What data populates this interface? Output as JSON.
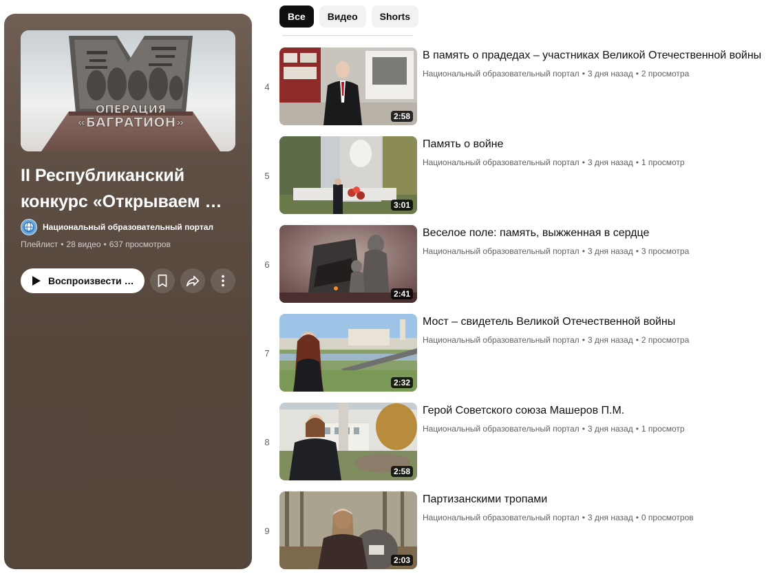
{
  "filters": {
    "chips": [
      {
        "label": "Все",
        "active": true
      },
      {
        "label": "Видео",
        "active": false
      },
      {
        "label": "Shorts",
        "active": false
      }
    ]
  },
  "playlist": {
    "title": "II Республиканский конкурс «Открываем …",
    "channel": "Национальный образовательный портал",
    "type": "Плейлист",
    "video_count": "28 видео",
    "views": "637 просмотров",
    "thumbnail_text_line1": "ОПЕРАЦИЯ",
    "thumbnail_text_line2": "«БАГРАТИОН»",
    "play_label": "Воспроизвести все"
  },
  "videos": [
    {
      "index": "4",
      "title": "В память о прадедах – участниках Великой Отечественной войны",
      "channel": "Национальный образовательный портал",
      "age": "3 дня назад",
      "views": "2 просмотра",
      "duration": "2:58"
    },
    {
      "index": "5",
      "title": "Память о войне",
      "channel": "Национальный образовательный портал",
      "age": "3 дня назад",
      "views": "1 просмотр",
      "duration": "3:01"
    },
    {
      "index": "6",
      "title": "Веселое поле: память, выжженная в сердце",
      "channel": "Национальный образовательный портал",
      "age": "3 дня назад",
      "views": "3 просмотра",
      "duration": "2:41"
    },
    {
      "index": "7",
      "title": "Мост – свидетель Великой Отечественной войны",
      "channel": "Национальный образовательный портал",
      "age": "3 дня назад",
      "views": "2 просмотра",
      "duration": "2:32"
    },
    {
      "index": "8",
      "title": "Герой Советского союза Машеров П.М.",
      "channel": "Национальный образовательный портал",
      "age": "3 дня назад",
      "views": "1 просмотр",
      "duration": "2:58"
    },
    {
      "index": "9",
      "title": "Партизанскими тропами",
      "channel": "Национальный образовательный портал",
      "age": "3 дня назад",
      "views": "0 просмотров",
      "duration": "2:03"
    }
  ],
  "icons": {
    "play": "play-icon",
    "save": "bookmark-icon",
    "share": "share-icon",
    "more": "more-vertical-icon"
  },
  "colors": {
    "panel_bg": "#55463c",
    "chip_active": "#0f0f0f",
    "chip_inactive": "#f2f2f2"
  }
}
